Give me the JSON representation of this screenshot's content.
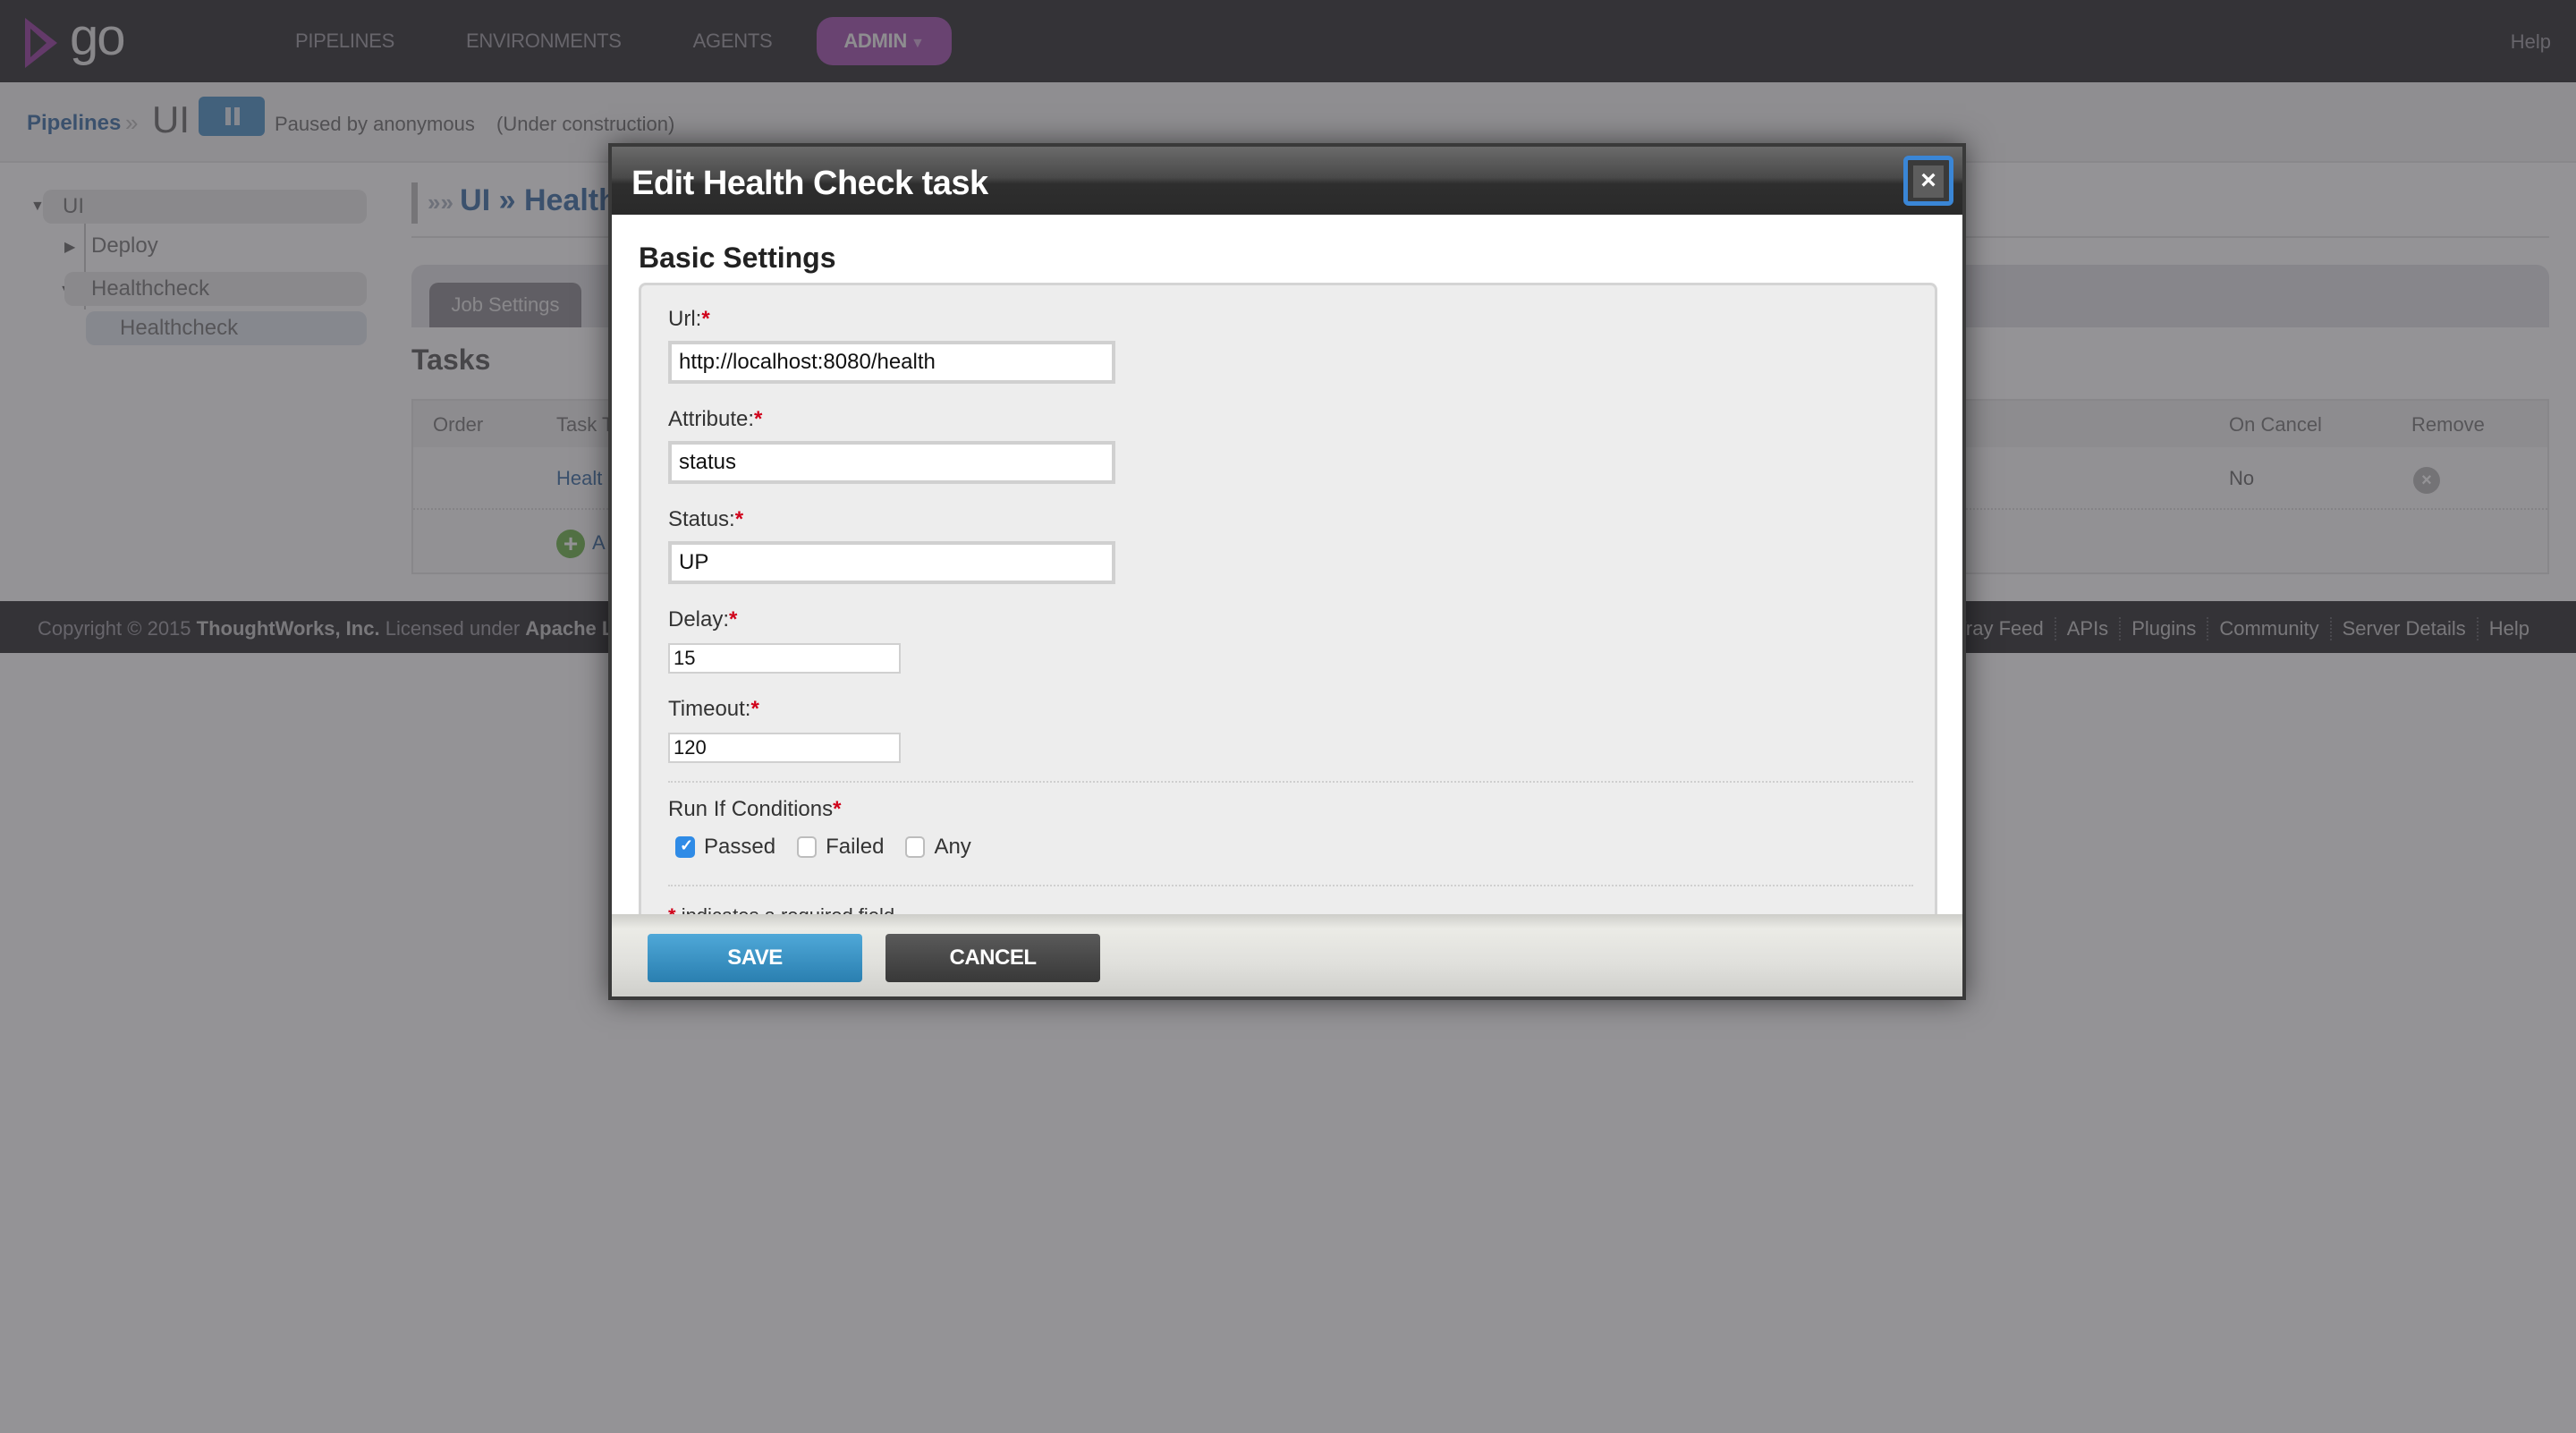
{
  "header": {
    "logo_text": "go",
    "nav": [
      "PIPELINES",
      "ENVIRONMENTS",
      "AGENTS",
      "ADMIN"
    ],
    "admin_caret": "▼",
    "help": "Help"
  },
  "breadcrumb": {
    "pipelines": "Pipelines",
    "separator": "»",
    "pipeline": "UI",
    "paused_by": "Paused by anonymous",
    "status": "(Under construction)"
  },
  "tree": {
    "root": "UI",
    "stages": [
      {
        "name": "Deploy",
        "expanded": false
      },
      {
        "name": "Healthcheck",
        "expanded": true,
        "jobs": [
          "Healthcheck"
        ]
      }
    ]
  },
  "main": {
    "title": "UI » Health",
    "tabs": [
      "Job Settings"
    ],
    "tasks_heading": "Tasks",
    "table": {
      "columns": [
        "Order",
        "Task T",
        "On Cancel",
        "Remove"
      ],
      "rows": [
        {
          "task": "Healt",
          "on_cancel": "No"
        }
      ],
      "add_label": "A"
    }
  },
  "footer": {
    "copyright": "Copyright © 2015",
    "company": "ThoughtWorks, Inc.",
    "licensed": "Licensed under",
    "license": "Apache Lic",
    "links": [
      "CCTray Feed",
      "APIs",
      "Plugins",
      "Community",
      "Server Details",
      "Help"
    ]
  },
  "modal": {
    "title": "Edit Health Check task",
    "close_label": "×",
    "section_title": "Basic Settings",
    "fields": {
      "url": {
        "label": "Url:",
        "value": "http://localhost:8080/health"
      },
      "attribute": {
        "label": "Attribute:",
        "value": "status"
      },
      "status": {
        "label": "Status:",
        "value": "UP"
      },
      "delay": {
        "label": "Delay:",
        "value": "15"
      },
      "timeout": {
        "label": "Timeout:",
        "value": "120"
      }
    },
    "required_marker": "*",
    "run_if": {
      "label": "Run If Conditions",
      "options": [
        {
          "label": "Passed",
          "checked": true
        },
        {
          "label": "Failed",
          "checked": false
        },
        {
          "label": "Any",
          "checked": false
        }
      ]
    },
    "required_note": "indicates a required field",
    "save_label": "SAVE",
    "cancel_label": "CANCEL"
  },
  "colors": {
    "accent_blue": "#2f8be6",
    "save_button": "#3a93c6",
    "cancel_button": "#474747",
    "required": "#d0021b",
    "admin_tab": "#a04fae"
  }
}
